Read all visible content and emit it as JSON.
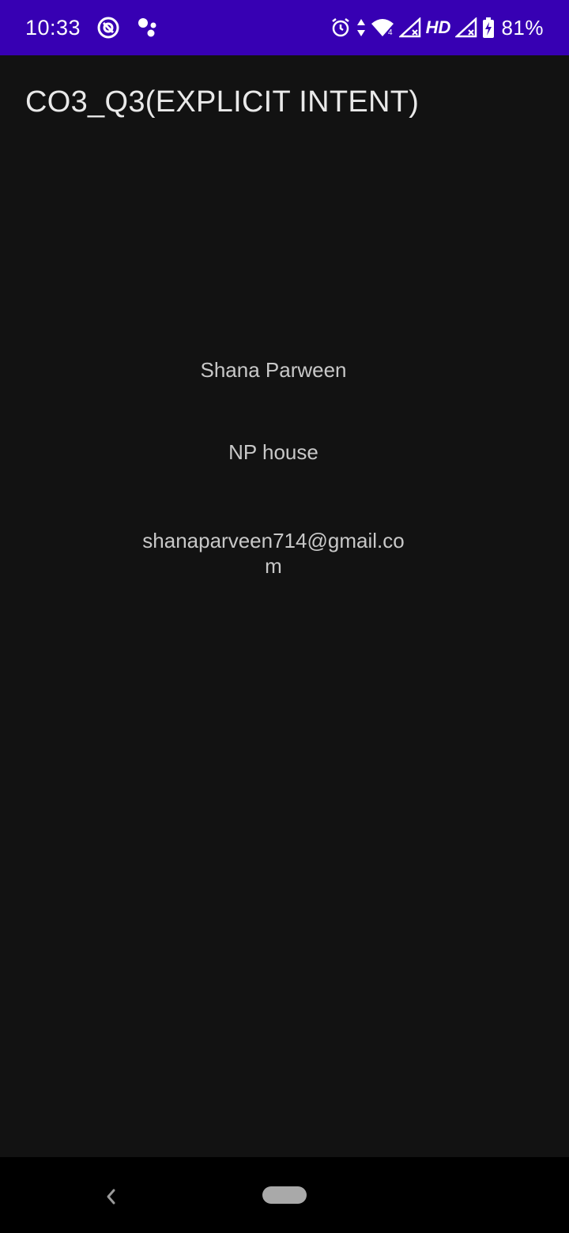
{
  "status_bar": {
    "time": "10:33",
    "network_label": "HD",
    "battery_percent": "81%",
    "background_color": "#3700b3",
    "icons": [
      "assistant-notification-icon",
      "dots-notification-icon",
      "alarm-icon",
      "data-arrows-icon",
      "wifi-icon",
      "signal-icon",
      "battery-charging-icon"
    ]
  },
  "app_bar": {
    "title": "CO3_Q3(EXPLICIT INTENT)"
  },
  "content": {
    "name": "Shana Parween",
    "address": "NP house",
    "email": "shanaparveen714@gmail.com"
  },
  "nav_bar": {
    "icons": [
      "back-icon",
      "home-pill-icon"
    ]
  }
}
